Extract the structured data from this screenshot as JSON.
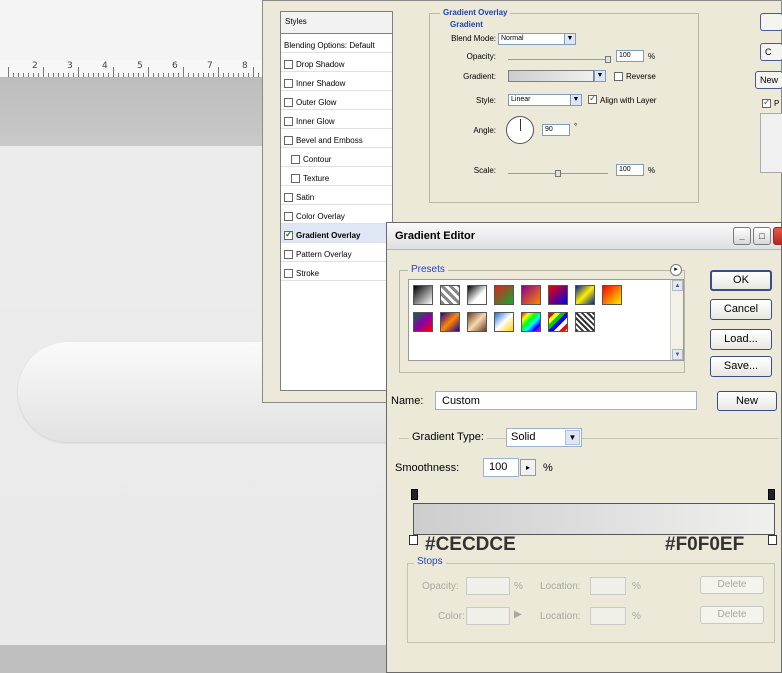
{
  "ruler": {
    "numbers": [
      "2",
      "3",
      "4",
      "5",
      "6",
      "7",
      "8"
    ]
  },
  "layer_style": {
    "styles_header": "Styles",
    "items": [
      {
        "label": "Blending Options: Default",
        "checkbox": false,
        "checked": false,
        "sub": false
      },
      {
        "label": "Drop Shadow",
        "checkbox": true,
        "checked": false,
        "sub": false
      },
      {
        "label": "Inner Shadow",
        "checkbox": true,
        "checked": false,
        "sub": false
      },
      {
        "label": "Outer Glow",
        "checkbox": true,
        "checked": false,
        "sub": false
      },
      {
        "label": "Inner Glow",
        "checkbox": true,
        "checked": false,
        "sub": false
      },
      {
        "label": "Bevel and Emboss",
        "checkbox": true,
        "checked": false,
        "sub": false
      },
      {
        "label": "Contour",
        "checkbox": true,
        "checked": false,
        "sub": true
      },
      {
        "label": "Texture",
        "checkbox": true,
        "checked": false,
        "sub": true
      },
      {
        "label": "Satin",
        "checkbox": true,
        "checked": false,
        "sub": false
      },
      {
        "label": "Color Overlay",
        "checkbox": true,
        "checked": false,
        "sub": false
      },
      {
        "label": "Gradient Overlay",
        "checkbox": true,
        "checked": true,
        "sub": false,
        "selected": true
      },
      {
        "label": "Pattern Overlay",
        "checkbox": true,
        "checked": false,
        "sub": false
      },
      {
        "label": "Stroke",
        "checkbox": true,
        "checked": false,
        "sub": false
      }
    ],
    "gradient_overlay": {
      "title": "Gradient Overlay",
      "subtitle": "Gradient",
      "blend_mode_label": "Blend Mode:",
      "blend_mode": "Normal",
      "opacity_label": "Opacity:",
      "opacity": "100",
      "opacity_unit": "%",
      "opacity_level": 1.0,
      "gradient_label": "Gradient:",
      "reverse_label": "Reverse",
      "reverse_checked": false,
      "style_label": "Style:",
      "style": "Linear",
      "align_label": "Align with Layer",
      "align_checked": true,
      "angle_label": "Angle:",
      "angle": "90",
      "angle_unit": "°",
      "scale_label": "Scale:",
      "scale": "100",
      "scale_unit": "%",
      "scale_level": 0.5
    },
    "right_buttons": [
      "C",
      "New",
      "P"
    ]
  },
  "gradient_editor": {
    "title": "Gradient Editor",
    "presets_title": "Presets",
    "buttons": {
      "ok": "OK",
      "cancel": "Cancel",
      "load": "Load...",
      "save": "Save...",
      "new": "New"
    },
    "name_label": "Name:",
    "name_value": "Custom",
    "gradient_type_label": "Gradient Type:",
    "gradient_type": "Solid",
    "smoothness_label": "Smoothness:",
    "smoothness": "100",
    "smoothness_unit": "%",
    "color_start": "#CECDCE",
    "color_end": "#F0F0EF",
    "stops": {
      "title": "Stops",
      "opacity_label": "Opacity:",
      "location_label": "Location:",
      "color_label": "Color:",
      "pct": "%",
      "delete_label": "Delete"
    },
    "swatches": [
      {
        "css": "linear-gradient(135deg,#000,#fff)"
      },
      {
        "css": "repeating-linear-gradient(45deg,#888 0 3px,#fff 3px 6px)"
      },
      {
        "css": "linear-gradient(135deg,#000,#fff 60%,#fff)"
      },
      {
        "css": "linear-gradient(135deg,#d22 0%,#1a3 100%)"
      },
      {
        "css": "linear-gradient(135deg,#8a0088,#ff8800)"
      },
      {
        "css": "linear-gradient(135deg,#e00,#00e)"
      },
      {
        "css": "linear-gradient(135deg,#002299,#ffee00,#002299)"
      },
      {
        "css": "linear-gradient(135deg,#ff0000,#ffee00)"
      },
      {
        "css": "linear-gradient(135deg,#0a6b3a,#8800aa,#ff0000)"
      },
      {
        "css": "linear-gradient(135deg,#220099,#ff8800,#220099)"
      },
      {
        "css": "linear-gradient(135deg,#6b3d1e,#f7d8b0,#6b3d1e)"
      },
      {
        "css": "linear-gradient(135deg,#1a73d6,#fff,#ffd000)"
      },
      {
        "css": "linear-gradient(135deg,#f00,#ff0,#0f0,#0ff,#00f,#f0f)"
      },
      {
        "css": "repeating-linear-gradient(135deg,#f00 0 4px,#ff0 4px 8px,#0c0 8px 12px,#00f 12px 16px,#fff 16px 20px)"
      },
      {
        "css": "repeating-linear-gradient(45deg,#333 0 2px,#fff 2px 4px)"
      }
    ]
  }
}
